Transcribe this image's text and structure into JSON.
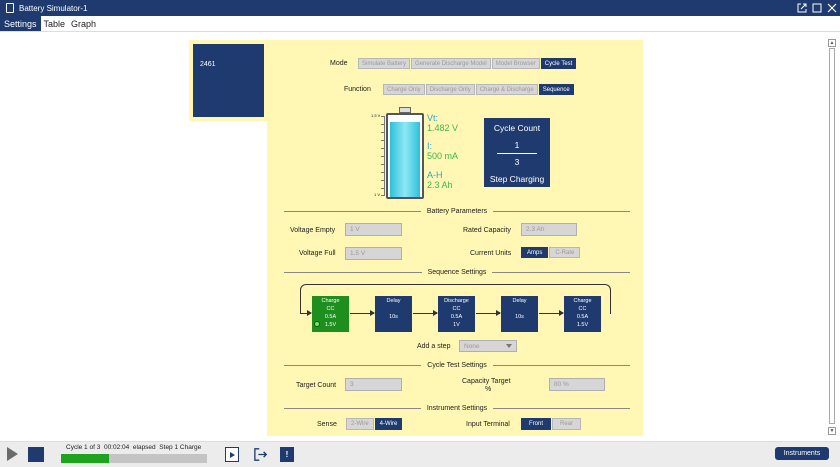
{
  "window": {
    "title": "Battery Simulator-1"
  },
  "tabs": [
    {
      "label": "Settings",
      "active": true
    },
    {
      "label": "Table",
      "active": false
    },
    {
      "label": "Graph",
      "active": false
    }
  ],
  "instrument": {
    "id": "2461"
  },
  "mode": {
    "label": "Mode",
    "options": [
      "Simulate Battery",
      "Generate Discharge Model",
      "Model Browser",
      "Cycle Test"
    ],
    "selected": "Cycle Test"
  },
  "function": {
    "label": "Function",
    "options": [
      "Charge Only",
      "Discharge Only",
      "Charge & Discharge",
      "Sequence"
    ],
    "selected": "Sequence"
  },
  "battery": {
    "scale_top": "1.5 V",
    "scale_bottom": "1 V",
    "fill_level": 0.96,
    "vt_label": "Vt:",
    "vt_value": "1.482 V",
    "i_label": "I:",
    "i_value": "500 mA",
    "ah_label": "A-H",
    "ah_value": "2.3 Ah"
  },
  "cycle_count": {
    "title": "Cycle Count",
    "current": "1",
    "total": "3",
    "status": "Step Charging"
  },
  "battery_parameters": {
    "heading": "Battery Parameters",
    "voltage_empty_label": "Voltage Empty",
    "voltage_empty_value": "1 V",
    "voltage_full_label": "Voltage Full",
    "voltage_full_value": "1.5 V",
    "rated_capacity_label": "Rated Capacity",
    "rated_capacity_value": "2.3 Ah",
    "current_units_label": "Current Units",
    "current_units_options": [
      "Amps",
      "C-Rate"
    ],
    "current_units_selected": "Amps"
  },
  "sequence": {
    "heading": "Sequence Settings",
    "steps": [
      {
        "lines": [
          "Charge",
          "CC",
          "0.5A",
          "1.5V"
        ],
        "active": true
      },
      {
        "lines": [
          "Delay",
          "",
          "10s",
          ""
        ],
        "active": false
      },
      {
        "lines": [
          "Discharge",
          "CC",
          "0.5A",
          "1V"
        ],
        "active": false
      },
      {
        "lines": [
          "Delay",
          "",
          "10s",
          ""
        ],
        "active": false
      },
      {
        "lines": [
          "Charge",
          "CC",
          "0.5A",
          "1.5V"
        ],
        "active": false
      }
    ],
    "add_step_label": "Add a step",
    "add_step_value": "None"
  },
  "cycle_test": {
    "heading": "Cycle Test Settings",
    "target_count_label": "Target Count",
    "target_count_value": "3",
    "capacity_target_label_1": "Capacity Target",
    "capacity_target_label_2": "%",
    "capacity_target_value": "80 %"
  },
  "instrument_settings": {
    "heading": "Instrument Settings",
    "sense_label": "Sense",
    "sense_options": [
      "2-Wire",
      "4-Wire"
    ],
    "sense_selected": "4-Wire",
    "terminal_label": "Input Terminal",
    "terminal_options": [
      "Front",
      "Rear"
    ],
    "terminal_selected": "Front"
  },
  "status_bar": {
    "cycle_text": "Cycle 1 of 3",
    "elapsed_time": "00:02:04",
    "elapsed_label": "elapsed",
    "step_text": "Step 1 Charge",
    "progress": 0.33,
    "instruments_button": "Instruments"
  }
}
